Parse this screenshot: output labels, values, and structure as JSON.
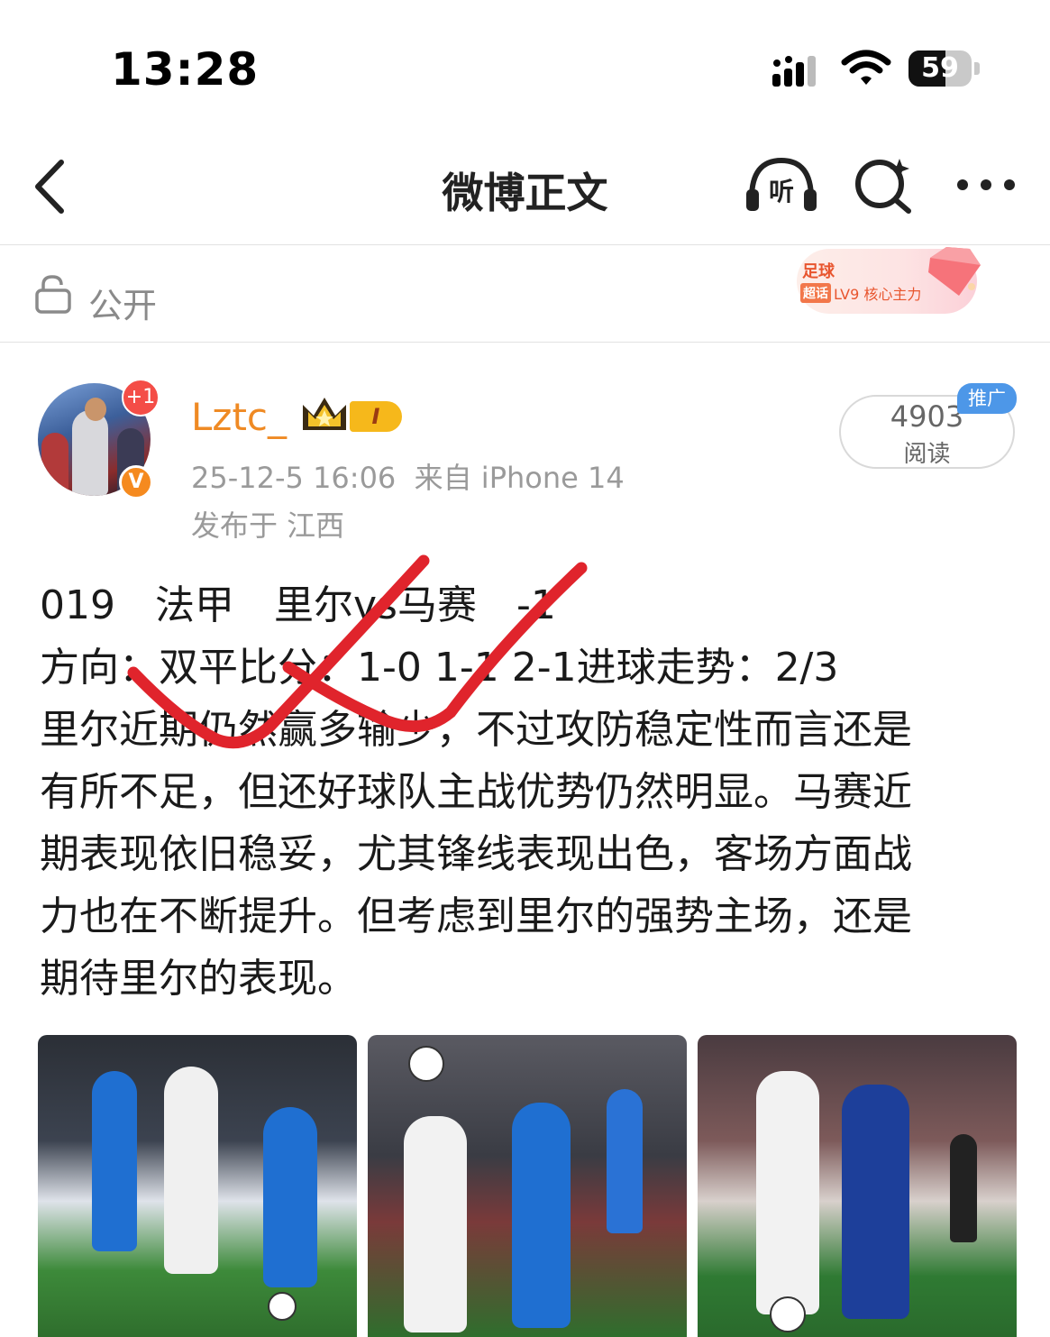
{
  "status_bar": {
    "time": "13:28",
    "battery": "59",
    "battery_level": 0.59
  },
  "nav": {
    "title": "微博正文",
    "listen_icon": "listen-headphone-icon",
    "search_icon": "search-icon",
    "more_icon": "more-icon"
  },
  "visibility": {
    "label": "公开",
    "icon": "unlock-icon"
  },
  "badge": {
    "title": "足球",
    "tag": "超话",
    "level": "LV9 核心主力"
  },
  "author": {
    "name": "Lztc_",
    "plus_one": "+1",
    "verified": "V",
    "level_tag": "I",
    "timestamp": "25-12-5 16:06",
    "source": "来自 iPhone 14",
    "location": "发布于 江西"
  },
  "reads": {
    "count": "4903",
    "label": "阅读",
    "promo": "推广"
  },
  "post": {
    "lines": [
      "019　法甲　里尔vs马赛　-1",
      "方向：双平比分：1-0 1-1 2-1进球走势：2/3",
      "里尔近期仍然赢多输少，不过攻防稳定性而言还是",
      "有所不足，但还好球队主战优势仍然明显。马赛近",
      "期表现依旧稳妥，尤其锋线表现出色，客场方面战",
      "力也在不断提升。但考虑到里尔的强势主场，还是",
      "期待里尔的表现。"
    ]
  },
  "colors": {
    "accent_orange": "#ef8a24",
    "annotation_red": "#e0242c",
    "promo_blue": "#4d97e8"
  }
}
